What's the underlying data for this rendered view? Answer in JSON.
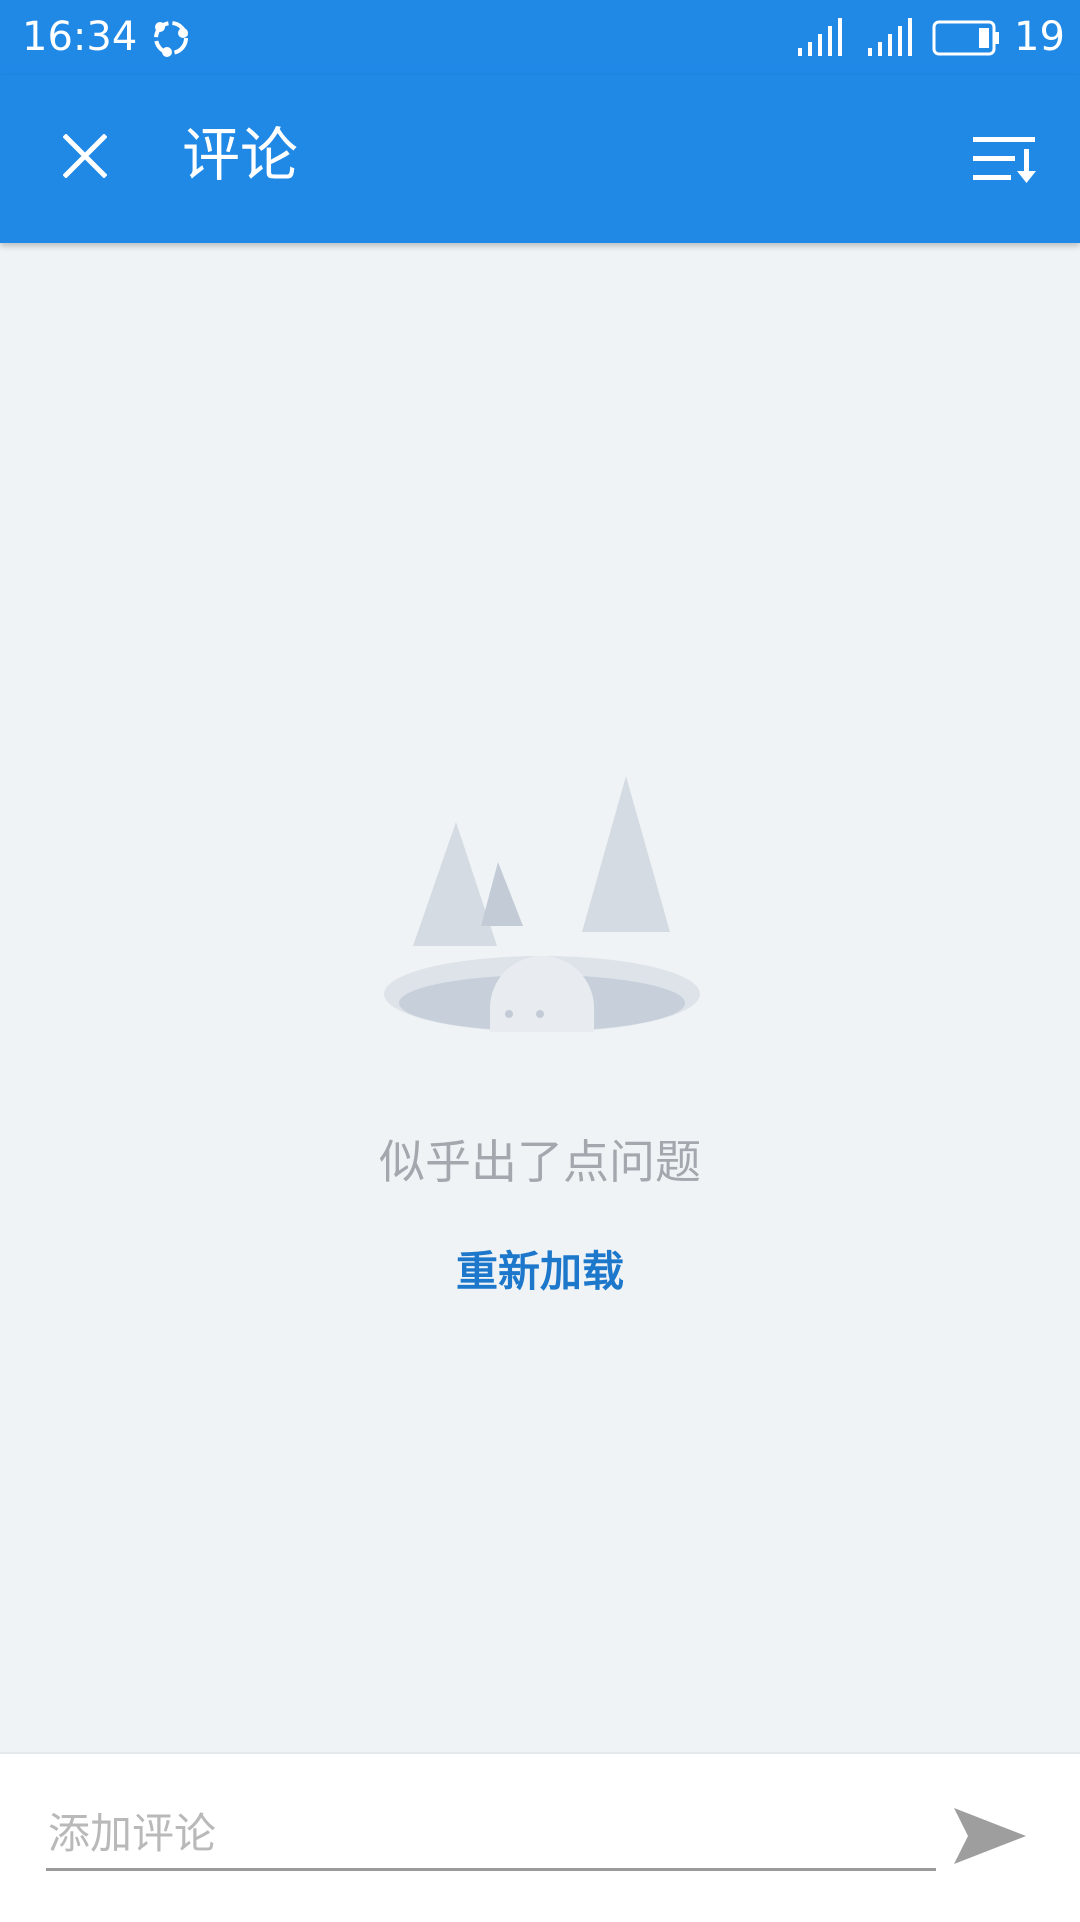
{
  "status_bar": {
    "time": "16:34",
    "battery_level": "19",
    "icons": [
      "sync-icon",
      "signal-icon",
      "signal-icon",
      "battery-icon"
    ]
  },
  "app_bar": {
    "title": "评论",
    "close_icon": "close-icon",
    "sort_icon": "sort-icon",
    "background_color": "#2089e6"
  },
  "empty_state": {
    "illustration": "empty-hole-illustration",
    "message": "似乎出了点问题",
    "reload_label": "重新加载",
    "reload_color": "#1d78cc"
  },
  "comment_bar": {
    "placeholder": "添加评论",
    "value": "",
    "send_icon": "send-icon"
  }
}
